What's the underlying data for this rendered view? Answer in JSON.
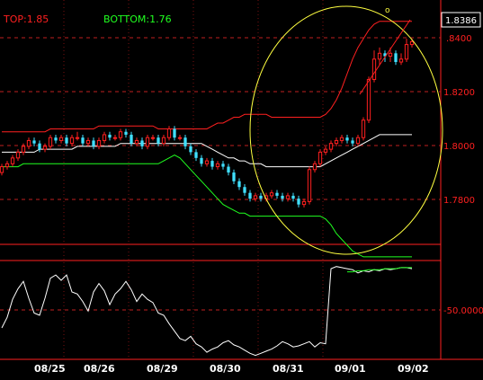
{
  "indicator": {
    "top_label": "TOP:1.85",
    "bottom_label": "BOTTOM:1.76",
    "top_color": "#ff2020",
    "bottom_color": "#20ff20"
  },
  "price_axis": {
    "current_price": "1.8386",
    "tick_labels": [
      ".8400",
      "1.8200",
      "1.8000",
      "1.7800"
    ]
  },
  "oscillator_axis": {
    "tick_label": "-50.0000"
  },
  "date_axis": {
    "labels": [
      "08/25",
      "08/26",
      "08/29",
      "08/30",
      "08/31",
      "09/01",
      "09/02"
    ]
  },
  "annotation": {
    "marker_text": "o",
    "circle_color": "#ffff40"
  },
  "chart_data": [
    {
      "type": "candlestick",
      "x": [
        "08/25",
        "08/25",
        "08/25",
        "08/25",
        "08/25",
        "08/25",
        "08/25",
        "08/25",
        "08/25",
        "08/25",
        "08/25",
        "08/25",
        "08/26",
        "08/26",
        "08/26",
        "08/26",
        "08/26",
        "08/26",
        "08/26",
        "08/26",
        "08/26",
        "08/26",
        "08/26",
        "08/26",
        "08/29",
        "08/29",
        "08/29",
        "08/29",
        "08/29",
        "08/29",
        "08/29",
        "08/29",
        "08/29",
        "08/29",
        "08/29",
        "08/29",
        "08/30",
        "08/30",
        "08/30",
        "08/30",
        "08/30",
        "08/30",
        "08/30",
        "08/30",
        "08/30",
        "08/30",
        "08/30",
        "08/30",
        "08/31",
        "08/31",
        "08/31",
        "08/31",
        "08/31",
        "08/31",
        "08/31",
        "08/31",
        "08/31",
        "08/31",
        "08/31",
        "08/31",
        "09/01",
        "09/01",
        "09/01",
        "09/01",
        "09/01",
        "09/01",
        "09/01",
        "09/01",
        "09/01",
        "09/01",
        "09/01",
        "09/01"
      ],
      "open": [
        1.794,
        1.796,
        1.797,
        1.799,
        1.801,
        1.803,
        1.805,
        1.804,
        1.802,
        1.803,
        1.806,
        1.805,
        1.806,
        1.804,
        1.806,
        1.806,
        1.804,
        1.805,
        1.803,
        1.805,
        1.807,
        1.806,
        1.806,
        1.808,
        1.807,
        1.804,
        1.805,
        1.803,
        1.806,
        1.806,
        1.804,
        1.806,
        1.809,
        1.806,
        1.806,
        1.803,
        1.801,
        1.799,
        1.797,
        1.798,
        1.796,
        1.797,
        1.796,
        1.794,
        1.791,
        1.789,
        1.787,
        1.785,
        1.786,
        1.785,
        1.786,
        1.787,
        1.786,
        1.785,
        1.786,
        1.785,
        1.783,
        1.784,
        1.795,
        1.797,
        1.801,
        1.802,
        1.804,
        1.805,
        1.806,
        1.805,
        1.804,
        1.806,
        1.812,
        1.826,
        1.833,
        1.835,
        1.834,
        1.835,
        1.832,
        1.833,
        1.838
      ],
      "close": [
        1.796,
        1.797,
        1.799,
        1.801,
        1.803,
        1.805,
        1.804,
        1.802,
        1.803,
        1.806,
        1.805,
        1.806,
        1.804,
        1.806,
        1.806,
        1.804,
        1.805,
        1.803,
        1.805,
        1.807,
        1.806,
        1.806,
        1.808,
        1.807,
        1.804,
        1.805,
        1.803,
        1.806,
        1.806,
        1.804,
        1.806,
        1.809,
        1.806,
        1.806,
        1.803,
        1.801,
        1.799,
        1.797,
        1.798,
        1.796,
        1.797,
        1.796,
        1.794,
        1.791,
        1.789,
        1.787,
        1.785,
        1.786,
        1.785,
        1.786,
        1.787,
        1.786,
        1.785,
        1.786,
        1.785,
        1.783,
        1.784,
        1.795,
        1.797,
        1.801,
        1.802,
        1.804,
        1.805,
        1.806,
        1.805,
        1.804,
        1.806,
        1.812,
        1.826,
        1.833,
        1.835,
        1.834,
        1.835,
        1.832,
        1.833,
        1.838,
        1.839
      ],
      "high": [
        1.797,
        1.798,
        1.8,
        1.802,
        1.804,
        1.806,
        1.806,
        1.805,
        1.804,
        1.807,
        1.807,
        1.807,
        1.807,
        1.807,
        1.808,
        1.807,
        1.806,
        1.806,
        1.806,
        1.808,
        1.808,
        1.807,
        1.809,
        1.809,
        1.808,
        1.806,
        1.806,
        1.807,
        1.807,
        1.807,
        1.807,
        1.81,
        1.81,
        1.807,
        1.807,
        1.804,
        1.802,
        1.8,
        1.799,
        1.799,
        1.798,
        1.798,
        1.797,
        1.795,
        1.792,
        1.79,
        1.788,
        1.787,
        1.787,
        1.787,
        1.788,
        1.788,
        1.787,
        1.787,
        1.787,
        1.786,
        1.785,
        1.796,
        1.798,
        1.802,
        1.803,
        1.805,
        1.806,
        1.807,
        1.807,
        1.806,
        1.807,
        1.813,
        1.827,
        1.836,
        1.837,
        1.836,
        1.837,
        1.836,
        1.835,
        1.84,
        1.84
      ],
      "low": [
        1.793,
        1.795,
        1.796,
        1.798,
        1.8,
        1.802,
        1.803,
        1.801,
        1.801,
        1.802,
        1.804,
        1.804,
        1.803,
        1.803,
        1.805,
        1.803,
        1.803,
        1.802,
        1.802,
        1.804,
        1.805,
        1.805,
        1.805,
        1.806,
        1.803,
        1.803,
        1.802,
        1.802,
        1.805,
        1.803,
        1.803,
        1.805,
        1.805,
        1.805,
        1.802,
        1.8,
        1.798,
        1.796,
        1.796,
        1.795,
        1.795,
        1.795,
        1.793,
        1.79,
        1.788,
        1.786,
        1.784,
        1.784,
        1.784,
        1.784,
        1.785,
        1.785,
        1.784,
        1.784,
        1.784,
        1.782,
        1.782,
        1.783,
        1.794,
        1.796,
        1.8,
        1.801,
        1.803,
        1.804,
        1.804,
        1.803,
        1.803,
        1.805,
        1.811,
        1.825,
        1.831,
        1.832,
        1.832,
        1.831,
        1.831,
        1.832,
        1.837
      ],
      "overlays": {
        "upper_band": [
          1.808,
          1.808,
          1.808,
          1.808,
          1.808,
          1.808,
          1.808,
          1.808,
          1.808,
          1.809,
          1.809,
          1.809,
          1.809,
          1.809,
          1.809,
          1.809,
          1.809,
          1.809,
          1.81,
          1.81,
          1.81,
          1.81,
          1.81,
          1.81,
          1.81,
          1.81,
          1.81,
          1.81,
          1.81,
          1.809,
          1.809,
          1.809,
          1.809,
          1.809,
          1.809,
          1.809,
          1.809,
          1.809,
          1.809,
          1.81,
          1.811,
          1.811,
          1.812,
          1.813,
          1.813,
          1.814,
          1.814,
          1.814,
          1.814,
          1.814,
          1.813,
          1.813,
          1.813,
          1.813,
          1.813,
          1.813,
          1.813,
          1.813,
          1.813,
          1.813,
          1.814,
          1.816,
          1.819,
          1.823,
          1.828,
          1.833,
          1.837,
          1.84,
          1.843,
          1.845,
          1.846,
          1.846,
          1.846,
          1.846,
          1.846,
          1.846,
          1.846
        ],
        "middle_band": [
          1.801,
          1.801,
          1.801,
          1.801,
          1.801,
          1.801,
          1.801,
          1.802,
          1.802,
          1.802,
          1.802,
          1.802,
          1.802,
          1.802,
          1.803,
          1.803,
          1.803,
          1.803,
          1.803,
          1.803,
          1.803,
          1.803,
          1.804,
          1.804,
          1.804,
          1.804,
          1.804,
          1.804,
          1.804,
          1.804,
          1.804,
          1.804,
          1.804,
          1.804,
          1.804,
          1.804,
          1.804,
          1.804,
          1.803,
          1.802,
          1.801,
          1.8,
          1.799,
          1.799,
          1.798,
          1.798,
          1.797,
          1.797,
          1.797,
          1.796,
          1.796,
          1.796,
          1.796,
          1.796,
          1.796,
          1.796,
          1.796,
          1.796,
          1.796,
          1.796,
          1.797,
          1.798,
          1.799,
          1.8,
          1.801,
          1.802,
          1.803,
          1.804,
          1.805,
          1.806,
          1.807,
          1.807,
          1.807,
          1.807,
          1.807,
          1.807,
          1.807
        ],
        "lower_band": [
          1.796,
          1.796,
          1.796,
          1.796,
          1.797,
          1.797,
          1.797,
          1.797,
          1.797,
          1.797,
          1.797,
          1.797,
          1.797,
          1.797,
          1.797,
          1.797,
          1.797,
          1.797,
          1.797,
          1.797,
          1.797,
          1.797,
          1.797,
          1.797,
          1.797,
          1.797,
          1.797,
          1.797,
          1.797,
          1.797,
          1.798,
          1.799,
          1.8,
          1.799,
          1.797,
          1.795,
          1.793,
          1.791,
          1.789,
          1.787,
          1.785,
          1.783,
          1.782,
          1.781,
          1.78,
          1.78,
          1.779,
          1.779,
          1.779,
          1.779,
          1.779,
          1.779,
          1.779,
          1.779,
          1.779,
          1.779,
          1.779,
          1.779,
          1.779,
          1.779,
          1.778,
          1.776,
          1.773,
          1.771,
          1.769,
          1.767,
          1.766,
          1.765,
          1.765,
          1.765,
          1.765,
          1.765,
          1.765,
          1.765,
          1.765,
          1.765,
          1.765
        ]
      },
      "ylim": [
        1.773,
        1.849
      ]
    },
    {
      "type": "line",
      "x": [
        "08/25",
        "08/25",
        "08/25",
        "08/25",
        "08/25",
        "08/25",
        "08/25",
        "08/25",
        "08/25",
        "08/25",
        "08/25",
        "08/25",
        "08/26",
        "08/26",
        "08/26",
        "08/26",
        "08/26",
        "08/26",
        "08/26",
        "08/26",
        "08/26",
        "08/26",
        "08/26",
        "08/26",
        "08/29",
        "08/29",
        "08/29",
        "08/29",
        "08/29",
        "08/29",
        "08/29",
        "08/29",
        "08/29",
        "08/29",
        "08/29",
        "08/29",
        "08/30",
        "08/30",
        "08/30",
        "08/30",
        "08/30",
        "08/30",
        "08/30",
        "08/30",
        "08/30",
        "08/30",
        "08/30",
        "08/30",
        "08/31",
        "08/31",
        "08/31",
        "08/31",
        "08/31",
        "08/31",
        "08/31",
        "08/31",
        "08/31",
        "08/31",
        "08/31",
        "08/31",
        "09/01",
        "09/01",
        "09/01",
        "09/01",
        "09/01",
        "09/01",
        "09/01",
        "09/01",
        "09/01",
        "09/01",
        "09/01",
        "09/01"
      ],
      "series": [
        {
          "color": "#ffffff",
          "values": [
            -72,
            -62,
            -45,
            -35,
            -28,
            -44,
            -58,
            -60,
            -44,
            -25,
            -22,
            -27,
            -22,
            -38,
            -40,
            -47,
            -56,
            -38,
            -30,
            -37,
            -50,
            -40,
            -35,
            -28,
            -36,
            -47,
            -40,
            -45,
            -48,
            -58,
            -60,
            -68,
            -75,
            -82,
            -84,
            -80,
            -87,
            -90,
            -95,
            -92,
            -90,
            -86,
            -84,
            -88,
            -90,
            -93,
            -96,
            -98,
            -96,
            -94,
            -92,
            -89,
            -85,
            -87,
            -90,
            -89,
            -87,
            -85,
            -90,
            -86,
            -87,
            -16,
            -14,
            -15,
            -16,
            -17,
            -20,
            -18,
            -19,
            -17,
            -18,
            -16,
            -17,
            -16,
            -15,
            -15,
            -16
          ]
        },
        {
          "color": "#20ff20",
          "values": [
            -19,
            -19,
            -18,
            -18,
            -17,
            -17,
            -17,
            -16,
            -16,
            -16,
            -15,
            -15,
            -15
          ]
        }
      ],
      "ylim": [
        -100,
        -10
      ]
    }
  ]
}
